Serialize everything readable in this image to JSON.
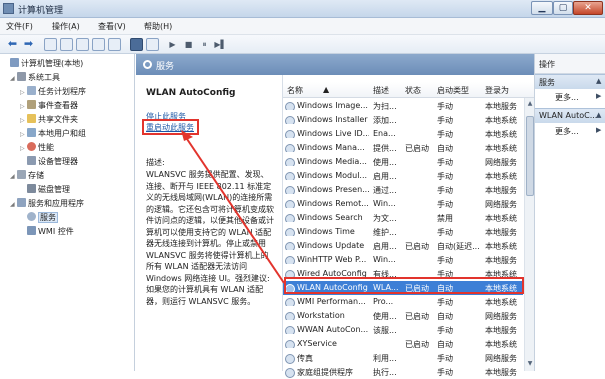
{
  "window": {
    "title": "计算机管理",
    "min": "▁",
    "max": "▢",
    "close": "✕"
  },
  "menu": [
    "文件(F)",
    "操作(A)",
    "查看(V)",
    "帮助(H)"
  ],
  "toolbar": {
    "back": "⬅",
    "forward": "➡",
    "play": "▶",
    "stop": "■",
    "pause": "⏸",
    "restart": "▶▌"
  },
  "tree": [
    {
      "label": "计算机管理(本地)",
      "expander": ""
    },
    {
      "label": "系统工具",
      "expander": "◢"
    },
    {
      "label": "任务计划程序",
      "expander": "▷"
    },
    {
      "label": "事件查看器",
      "expander": "▷"
    },
    {
      "label": "共享文件夹",
      "expander": "▷"
    },
    {
      "label": "本地用户和组",
      "expander": "▷"
    },
    {
      "label": "性能",
      "expander": "▷"
    },
    {
      "label": "设备管理器",
      "expander": ""
    },
    {
      "label": "存储",
      "expander": "◢"
    },
    {
      "label": "磁盘管理",
      "expander": ""
    },
    {
      "label": "服务和应用程序",
      "expander": "◢"
    },
    {
      "label": "服务",
      "expander": ""
    },
    {
      "label": "WMI 控件",
      "expander": ""
    }
  ],
  "services_header": "服务",
  "detail": {
    "service_name": "WLAN AutoConfig",
    "stop_link": "停止此服务",
    "restart_link": "重启动此服务",
    "desc_label": "描述:",
    "description": "WLANSVC 服务提供配置、发现、连接、断开与 IEEE 802.11 标准定义的无线局域网(WLAN)的连接所需的逻辑。它还包含可将计算机变成软件访问点的逻辑，以便其他设备或计算机可以使用支持它的 WLAN 适配器无线连接到计算机。停止或禁用 WLANSVC 服务将使得计算机上的所有 WLAN 适配器无法访问 Windows 网络连接 UI。强烈建议: 如果您的计算机具有 WLAN 适配器，则运行 WLANSVC 服务。"
  },
  "list": {
    "columns": {
      "name": "名称",
      "desc": "描述",
      "status": "状态",
      "startup": "启动类型",
      "logon": "登录为",
      "sort": "▲"
    },
    "rows": [
      {
        "name": "Windows Image...",
        "desc": "为扫...",
        "status": "",
        "startup": "手动",
        "logon": "本地服务"
      },
      {
        "name": "Windows Installer",
        "desc": "添加...",
        "status": "",
        "startup": "手动",
        "logon": "本地系统"
      },
      {
        "name": "Windows Live ID...",
        "desc": "Ena...",
        "status": "",
        "startup": "手动",
        "logon": "本地系统"
      },
      {
        "name": "Windows Mana...",
        "desc": "提供...",
        "status": "已启动",
        "startup": "自动",
        "logon": "本地系统"
      },
      {
        "name": "Windows Media...",
        "desc": "使用...",
        "status": "",
        "startup": "手动",
        "logon": "网络服务"
      },
      {
        "name": "Windows Modul...",
        "desc": "启用...",
        "status": "",
        "startup": "手动",
        "logon": "本地系统"
      },
      {
        "name": "Windows Presen...",
        "desc": "通过...",
        "status": "",
        "startup": "手动",
        "logon": "本地服务"
      },
      {
        "name": "Windows Remot...",
        "desc": "Win...",
        "status": "",
        "startup": "手动",
        "logon": "网络服务"
      },
      {
        "name": "Windows Search",
        "desc": "为文...",
        "status": "",
        "startup": "禁用",
        "logon": "本地系统"
      },
      {
        "name": "Windows Time",
        "desc": "维护...",
        "status": "",
        "startup": "手动",
        "logon": "本地服务"
      },
      {
        "name": "Windows Update",
        "desc": "启用...",
        "status": "已启动",
        "startup": "自动(延迟...",
        "logon": "本地系统"
      },
      {
        "name": "WinHTTP Web P...",
        "desc": "Win...",
        "status": "",
        "startup": "手动",
        "logon": "本地服务"
      },
      {
        "name": "Wired AutoConfig",
        "desc": "有线...",
        "status": "",
        "startup": "手动",
        "logon": "本地系统"
      },
      {
        "name": "WLAN AutoConfig",
        "desc": "WLA...",
        "status": "已启动",
        "startup": "自动",
        "logon": "本地系统"
      },
      {
        "name": "WMI Performan...",
        "desc": "Pro...",
        "status": "",
        "startup": "手动",
        "logon": "本地系统"
      },
      {
        "name": "Workstation",
        "desc": "使用...",
        "status": "已启动",
        "startup": "自动",
        "logon": "网络服务"
      },
      {
        "name": "WWAN AutoCon...",
        "desc": "该服...",
        "status": "",
        "startup": "手动",
        "logon": "本地服务"
      },
      {
        "name": "XYService",
        "desc": "",
        "status": "已启动",
        "startup": "自动",
        "logon": "本地系统"
      },
      {
        "name": "传真",
        "desc": "利用...",
        "status": "",
        "startup": "手动",
        "logon": "网络服务"
      },
      {
        "name": "家庭组提供程序",
        "desc": "执行...",
        "status": "",
        "startup": "手动",
        "logon": "本地服务"
      }
    ]
  },
  "actions": {
    "header": "操作",
    "groups": [
      {
        "title": "服务",
        "more": "更多...",
        "arrow": "▲",
        "more_arrow": "▶"
      },
      {
        "title": "WLAN AutoC...",
        "more": "更多...",
        "arrow": "▲",
        "more_arrow": "▶"
      }
    ]
  },
  "colors": {
    "highlight": "#e2342d",
    "selection": "#3d7fd6",
    "link": "#1c57a5"
  }
}
